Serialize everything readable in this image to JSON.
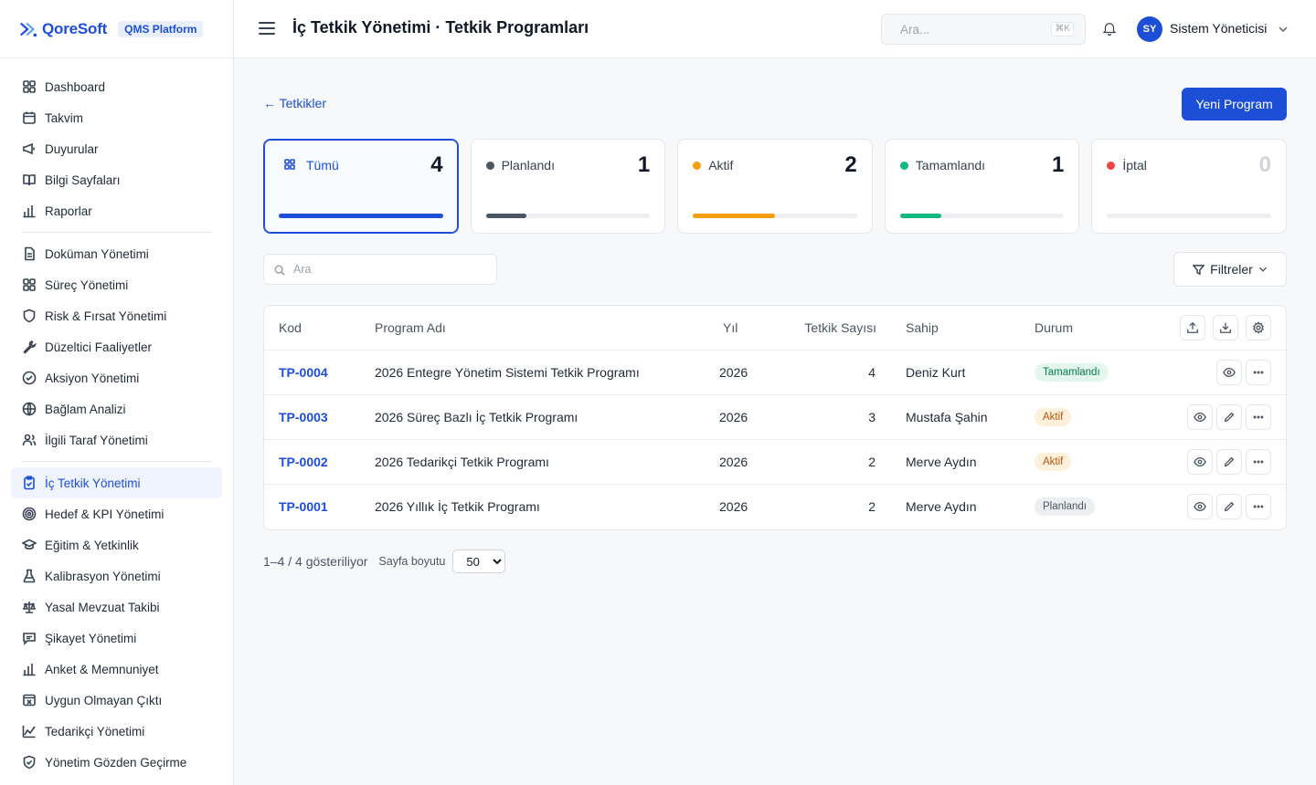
{
  "brand": {
    "name": "QoreSoft",
    "platform": "QMS Platform"
  },
  "sidebar": {
    "groups": [
      [
        {
          "label": "Dashboard",
          "icon": "dashboard-grid-icon"
        },
        {
          "label": "Takvim",
          "icon": "calendar-icon"
        },
        {
          "label": "Duyurular",
          "icon": "megaphone-icon"
        },
        {
          "label": "Bilgi Sayfaları",
          "icon": "book-icon"
        },
        {
          "label": "Raporlar",
          "icon": "bar-chart-icon"
        }
      ],
      [
        {
          "label": "Doküman Yönetimi",
          "icon": "document-icon"
        },
        {
          "label": "Süreç Yönetimi",
          "icon": "grid-icon"
        },
        {
          "label": "Risk & Fırsat Yönetimi",
          "icon": "shield-icon"
        },
        {
          "label": "Düzeltici Faaliyetler",
          "icon": "wrench-icon"
        },
        {
          "label": "Aksiyon Yönetimi",
          "icon": "check-circle-icon"
        },
        {
          "label": "Bağlam Analizi",
          "icon": "globe-icon"
        },
        {
          "label": "İlgili Taraf Yönetimi",
          "icon": "users-icon"
        }
      ],
      [
        {
          "label": "İç Tetkik Yönetimi",
          "icon": "clipboard-check-icon",
          "active": true
        },
        {
          "label": "Hedef & KPI Yönetimi",
          "icon": "target-icon"
        },
        {
          "label": "Eğitim & Yetkinlik",
          "icon": "graduation-cap-icon"
        },
        {
          "label": "Kalibrasyon Yönetimi",
          "icon": "flask-icon"
        },
        {
          "label": "Yasal Mevzuat Takibi",
          "icon": "scale-icon"
        },
        {
          "label": "Şikayet Yönetimi",
          "icon": "message-icon"
        },
        {
          "label": "Anket & Memnuniyet",
          "icon": "bar-chart-icon"
        },
        {
          "label": "Uygun Olmayan Çıktı",
          "icon": "x-box-icon"
        },
        {
          "label": "Tedarikçi Yönetimi",
          "icon": "factory-icon"
        },
        {
          "label": "Yönetim Gözden Geçirme",
          "icon": "shield-check-icon"
        }
      ]
    ]
  },
  "header": {
    "title": "İç Tetkik Yönetimi · Tetkik Programları",
    "search_placeholder": "Ara...",
    "shortcut": "⌘K",
    "user_initials": "SY",
    "user_name": "Sistem Yöneticisi"
  },
  "page": {
    "back_label": "← Tetkikler",
    "new_button": "Yeni Program",
    "search_placeholder": "Ara",
    "filter_label": "Filtreler"
  },
  "stats": [
    {
      "label": "Tümü",
      "count": "4",
      "fraction": 1.0,
      "color": "#1d4ed8",
      "selected": true
    },
    {
      "label": "Planlandı",
      "count": "1",
      "fraction": 0.25,
      "color": "#4b5563"
    },
    {
      "label": "Aktif",
      "count": "2",
      "fraction": 0.5,
      "color": "#f59e0b"
    },
    {
      "label": "Tamamlandı",
      "count": "1",
      "fraction": 0.25,
      "color": "#10b981"
    },
    {
      "label": "İptal",
      "count": "0",
      "fraction": 0,
      "color": "#ef4444",
      "muted": true
    }
  ],
  "table": {
    "columns": {
      "code": "Kod",
      "name": "Program Adı",
      "year": "Yıl",
      "count": "Tetkik Sayısı",
      "owner": "Sahip",
      "status": "Durum"
    },
    "rows": [
      {
        "code": "TP-0004",
        "name": "2026 Entegre Yönetim Sistemi Tetkik Programı",
        "year": "2026",
        "count": "4",
        "owner": "Deniz Kurt",
        "status": "Tamamlandı",
        "status_kind": "green",
        "editable": false
      },
      {
        "code": "TP-0003",
        "name": "2026 Süreç Bazlı İç Tetkik Programı",
        "year": "2026",
        "count": "3",
        "owner": "Mustafa Şahin",
        "status": "Aktif",
        "status_kind": "amber",
        "editable": true
      },
      {
        "code": "TP-0002",
        "name": "2026 Tedarikçi Tetkik Programı",
        "year": "2026",
        "count": "2",
        "owner": "Merve Aydın",
        "status": "Aktif",
        "status_kind": "amber",
        "editable": true
      },
      {
        "code": "TP-0001",
        "name": "2026 Yıllık İç Tetkik Programı",
        "year": "2026",
        "count": "2",
        "owner": "Merve Aydın",
        "status": "Planlandı",
        "status_kind": "gray",
        "editable": true
      }
    ]
  },
  "pager": {
    "summary": "1–4 / 4 gösteriliyor",
    "size_label": "Sayfa boyutu",
    "size_value": "50"
  }
}
